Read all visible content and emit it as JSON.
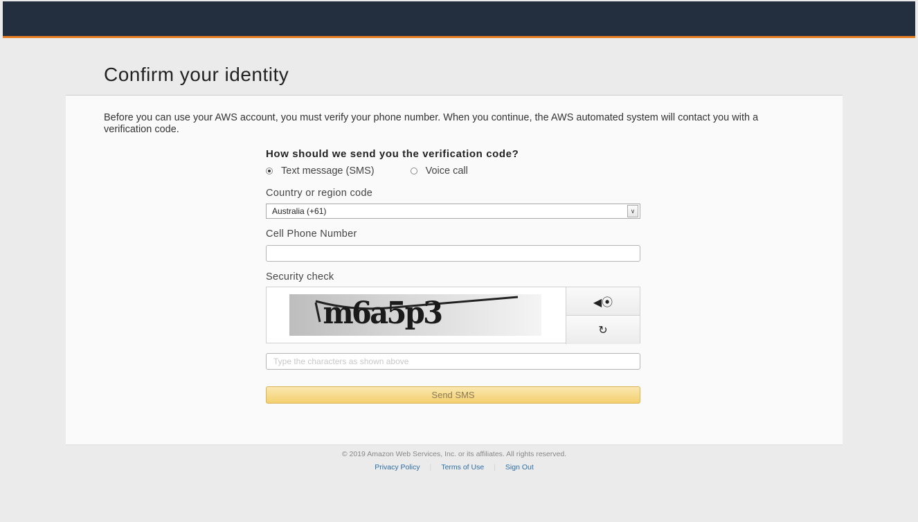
{
  "page": {
    "title": "Confirm your identity",
    "intro": "Before you can use your AWS account, you must verify your phone number. When you continue, the AWS automated system will contact you with a verification code."
  },
  "verification": {
    "question": "How should we send you the verification code?",
    "options": [
      {
        "label": "Text message (SMS)",
        "selected": true
      },
      {
        "label": "Voice call",
        "selected": false
      }
    ]
  },
  "country": {
    "label": "Country or region code",
    "value": "Australia (+61)"
  },
  "phone": {
    "label": "Cell Phone Number",
    "value": ""
  },
  "security": {
    "label": "Security check",
    "captcha_text": "m6a5p3",
    "input_placeholder": "Type the characters as shown above"
  },
  "actions": {
    "send_label": "Send SMS"
  },
  "footer": {
    "copyright": "© 2019 Amazon Web Services, Inc. or its affiliates. All rights reserved.",
    "links": [
      "Privacy Policy",
      "Terms of Use",
      "Sign Out"
    ]
  },
  "colors": {
    "topbar": "#232f3e",
    "accent": "#e67e22",
    "button": "#f4cf6e",
    "link": "#2b6ca3"
  }
}
